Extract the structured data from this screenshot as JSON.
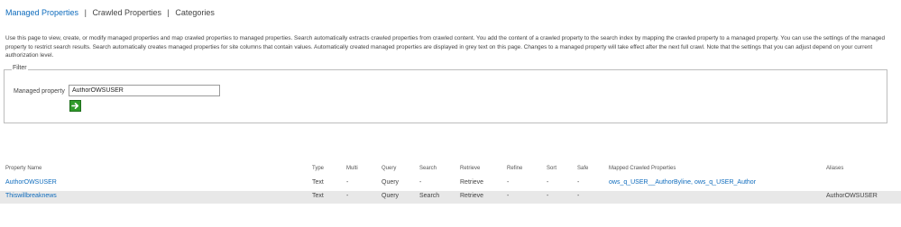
{
  "nav": {
    "tabs": [
      {
        "label": "Managed Properties",
        "active": true
      },
      {
        "label": "Crawled Properties",
        "active": false
      },
      {
        "label": "Categories",
        "active": false
      }
    ],
    "separator": "|"
  },
  "description": "Use this page to view, create, or modify managed properties and map crawled properties to managed properties. Search automatically extracts crawled properties from crawled content. You add the content of a crawled property to the search index by mapping the crawled property to a managed property. You can use the settings of the managed property to restrict search results. Search automatically creates managed properties for site columns that contain values. Automatically created managed properties are displayed in grey text on this page. Changes to a managed property will take effect after the next full crawl. Note that the settings that you can adjust depend on your current authorization level.",
  "filter": {
    "legend": "Filter",
    "label": "Managed property",
    "value": "AuthorOWSUSER",
    "go_icon": "arrow-right-icon"
  },
  "table": {
    "headers": {
      "name": "Property Name",
      "type": "Type",
      "multi": "Multi",
      "query": "Query",
      "search": "Search",
      "retrieve": "Retrieve",
      "refine": "Refine",
      "sort": "Sort",
      "safe": "Safe",
      "mapped": "Mapped Crawled Properties",
      "aliases": "Aliases"
    },
    "rows": [
      {
        "name": "AuthorOWSUSER",
        "type": "Text",
        "multi": "-",
        "query": "Query",
        "search": "-",
        "retrieve": "Retrieve",
        "refine": "-",
        "sort": "-",
        "safe": "-",
        "mapped": "ows_q_USER__AuthorByline, ows_q_USER_Author",
        "aliases": ""
      },
      {
        "name": "Thiswillbreaknews",
        "type": "Text",
        "multi": "-",
        "query": "Query",
        "search": "Search",
        "retrieve": "Retrieve",
        "refine": "-",
        "sort": "-",
        "safe": "-",
        "mapped": "",
        "aliases": "AuthorOWSUSER"
      }
    ]
  },
  "colors": {
    "link": "#0f6cbd",
    "text": "#444444",
    "row_alt": "#e8e8e8",
    "go_button": "#2f9b2a"
  }
}
